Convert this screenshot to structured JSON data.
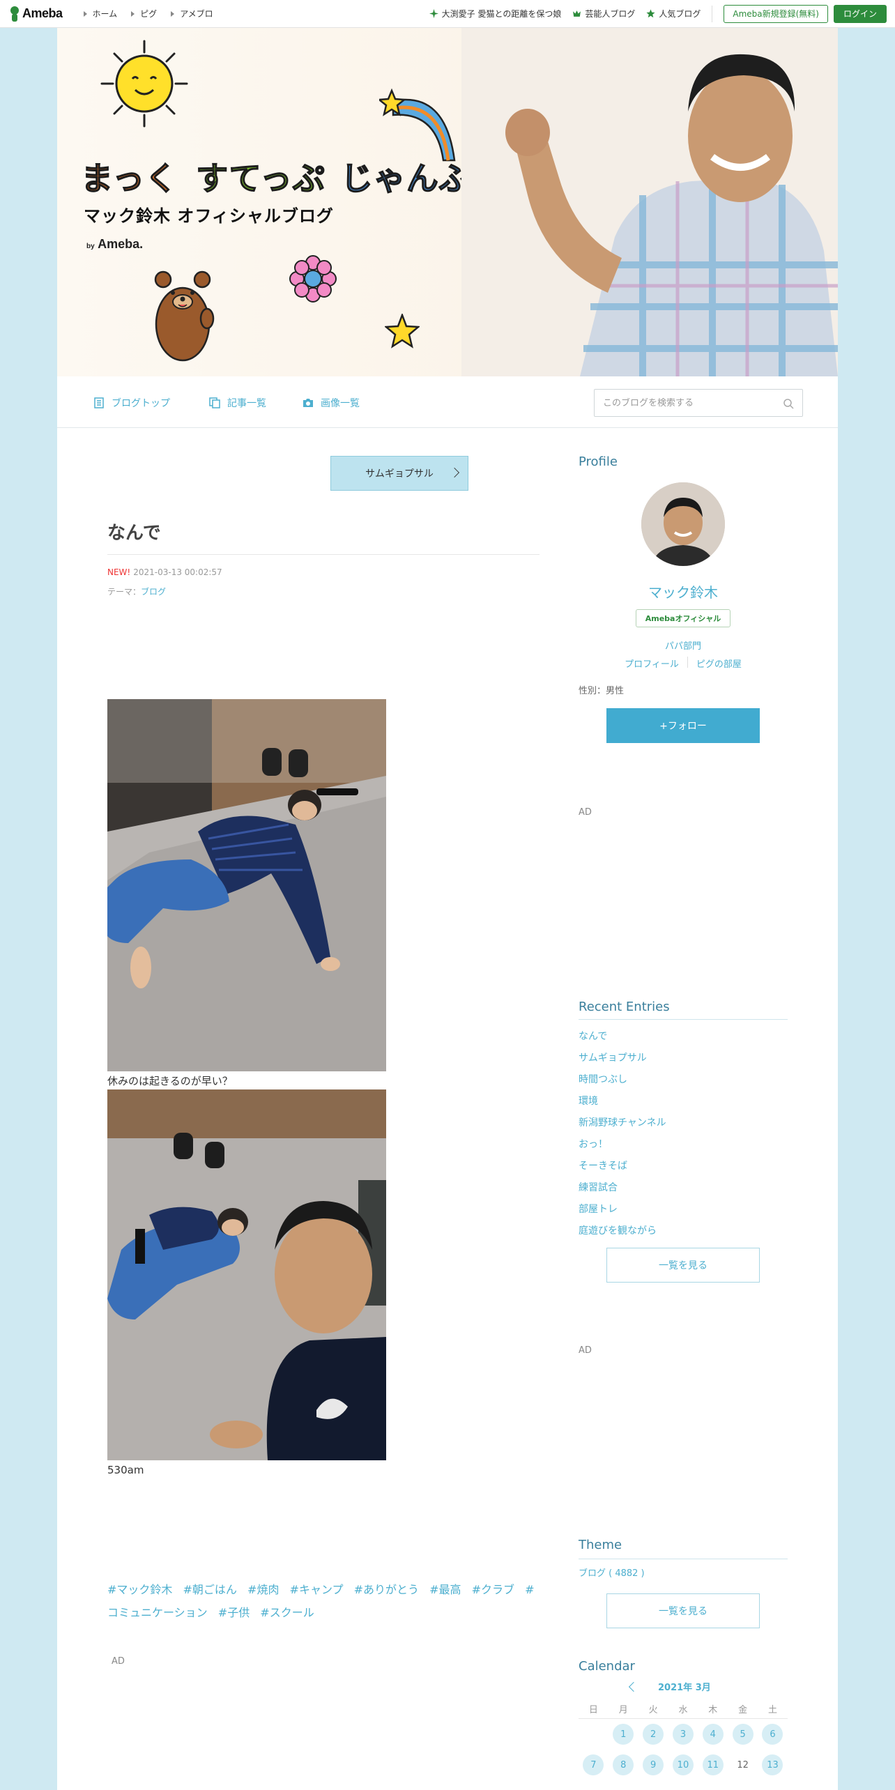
{
  "global_header": {
    "logo_text": "Ameba",
    "nav": [
      "ホーム",
      "ピグ",
      "アメブロ"
    ],
    "links": [
      {
        "label": "大渕愛子 愛猫との距離を保つ娘",
        "icon": "sparkle-icon"
      },
      {
        "label": "芸能人ブログ",
        "icon": "crown-icon"
      },
      {
        "label": "人気ブログ",
        "icon": "star-icon"
      }
    ],
    "register_label": "Ameba新規登録(無料)",
    "login_label": "ログイン",
    "accent": "#2d8c3c"
  },
  "banner": {
    "title_part1": "まっく",
    "title_part2": "すてっぷ",
    "title_part3": "じゃんぷ",
    "subtitle": "マック鈴木 オフィシャルブログ",
    "by_small": "by",
    "by_logo": "Ameba."
  },
  "blog_nav": {
    "items": [
      {
        "label": "ブログトップ",
        "icon": "document-icon"
      },
      {
        "label": "記事一覧",
        "icon": "copy-icon"
      },
      {
        "label": "画像一覧",
        "icon": "camera-icon"
      }
    ],
    "search_placeholder": "このブログを検索する"
  },
  "article": {
    "prev_label": "サムギョプサル",
    "title": "なんで",
    "new_label": "NEW!",
    "datetime": "2021-03-13 00:02:57",
    "theme_prefix": "テーマ：",
    "theme": "ブログ",
    "caption1": "休みのは起きるのが早い？",
    "caption2": "530am",
    "hashtags": [
      "#マック鈴木",
      "#朝ごはん",
      "#焼肉",
      "#キャンプ",
      "#ありがとう",
      "#最高",
      "#クラブ",
      "#コミュニケーション",
      "#子供",
      "#スクール"
    ],
    "ad_label": "AD"
  },
  "sidebar": {
    "profile_heading": "Profile",
    "name": "マック鈴木",
    "badge": "Amebaオフィシャル",
    "category": "パパ部門",
    "profile_link": "プロフィール",
    "pig_link": "ピグの部屋",
    "gender": "性別：男性",
    "follow_label": "+フォロー",
    "ad_label_1": "AD",
    "recent_heading": "Recent Entries",
    "recent_entries": [
      "なんで",
      "サムギョプサル",
      "時間つぶし",
      "環境",
      "新潟野球チャンネル",
      "おっ！",
      "そーきそば",
      "練習試合",
      "部屋トレ",
      "庭遊びを観ながら"
    ],
    "recent_more": "一覧を見る",
    "ad_label_2": "AD",
    "theme_heading": "Theme",
    "theme_item": "ブログ ( 4882 )",
    "theme_more": "一覧を見る",
    "calendar_heading": "Calendar",
    "calendar_month": "2021年 3月",
    "weekdays": [
      "日",
      "月",
      "火",
      "水",
      "木",
      "金",
      "土"
    ],
    "week1": [
      "",
      "1",
      "2",
      "3",
      "4",
      "5",
      "6"
    ],
    "week2": [
      "7",
      "8",
      "9",
      "10",
      "11",
      "12",
      "13"
    ],
    "accent": "#4dafcf"
  }
}
